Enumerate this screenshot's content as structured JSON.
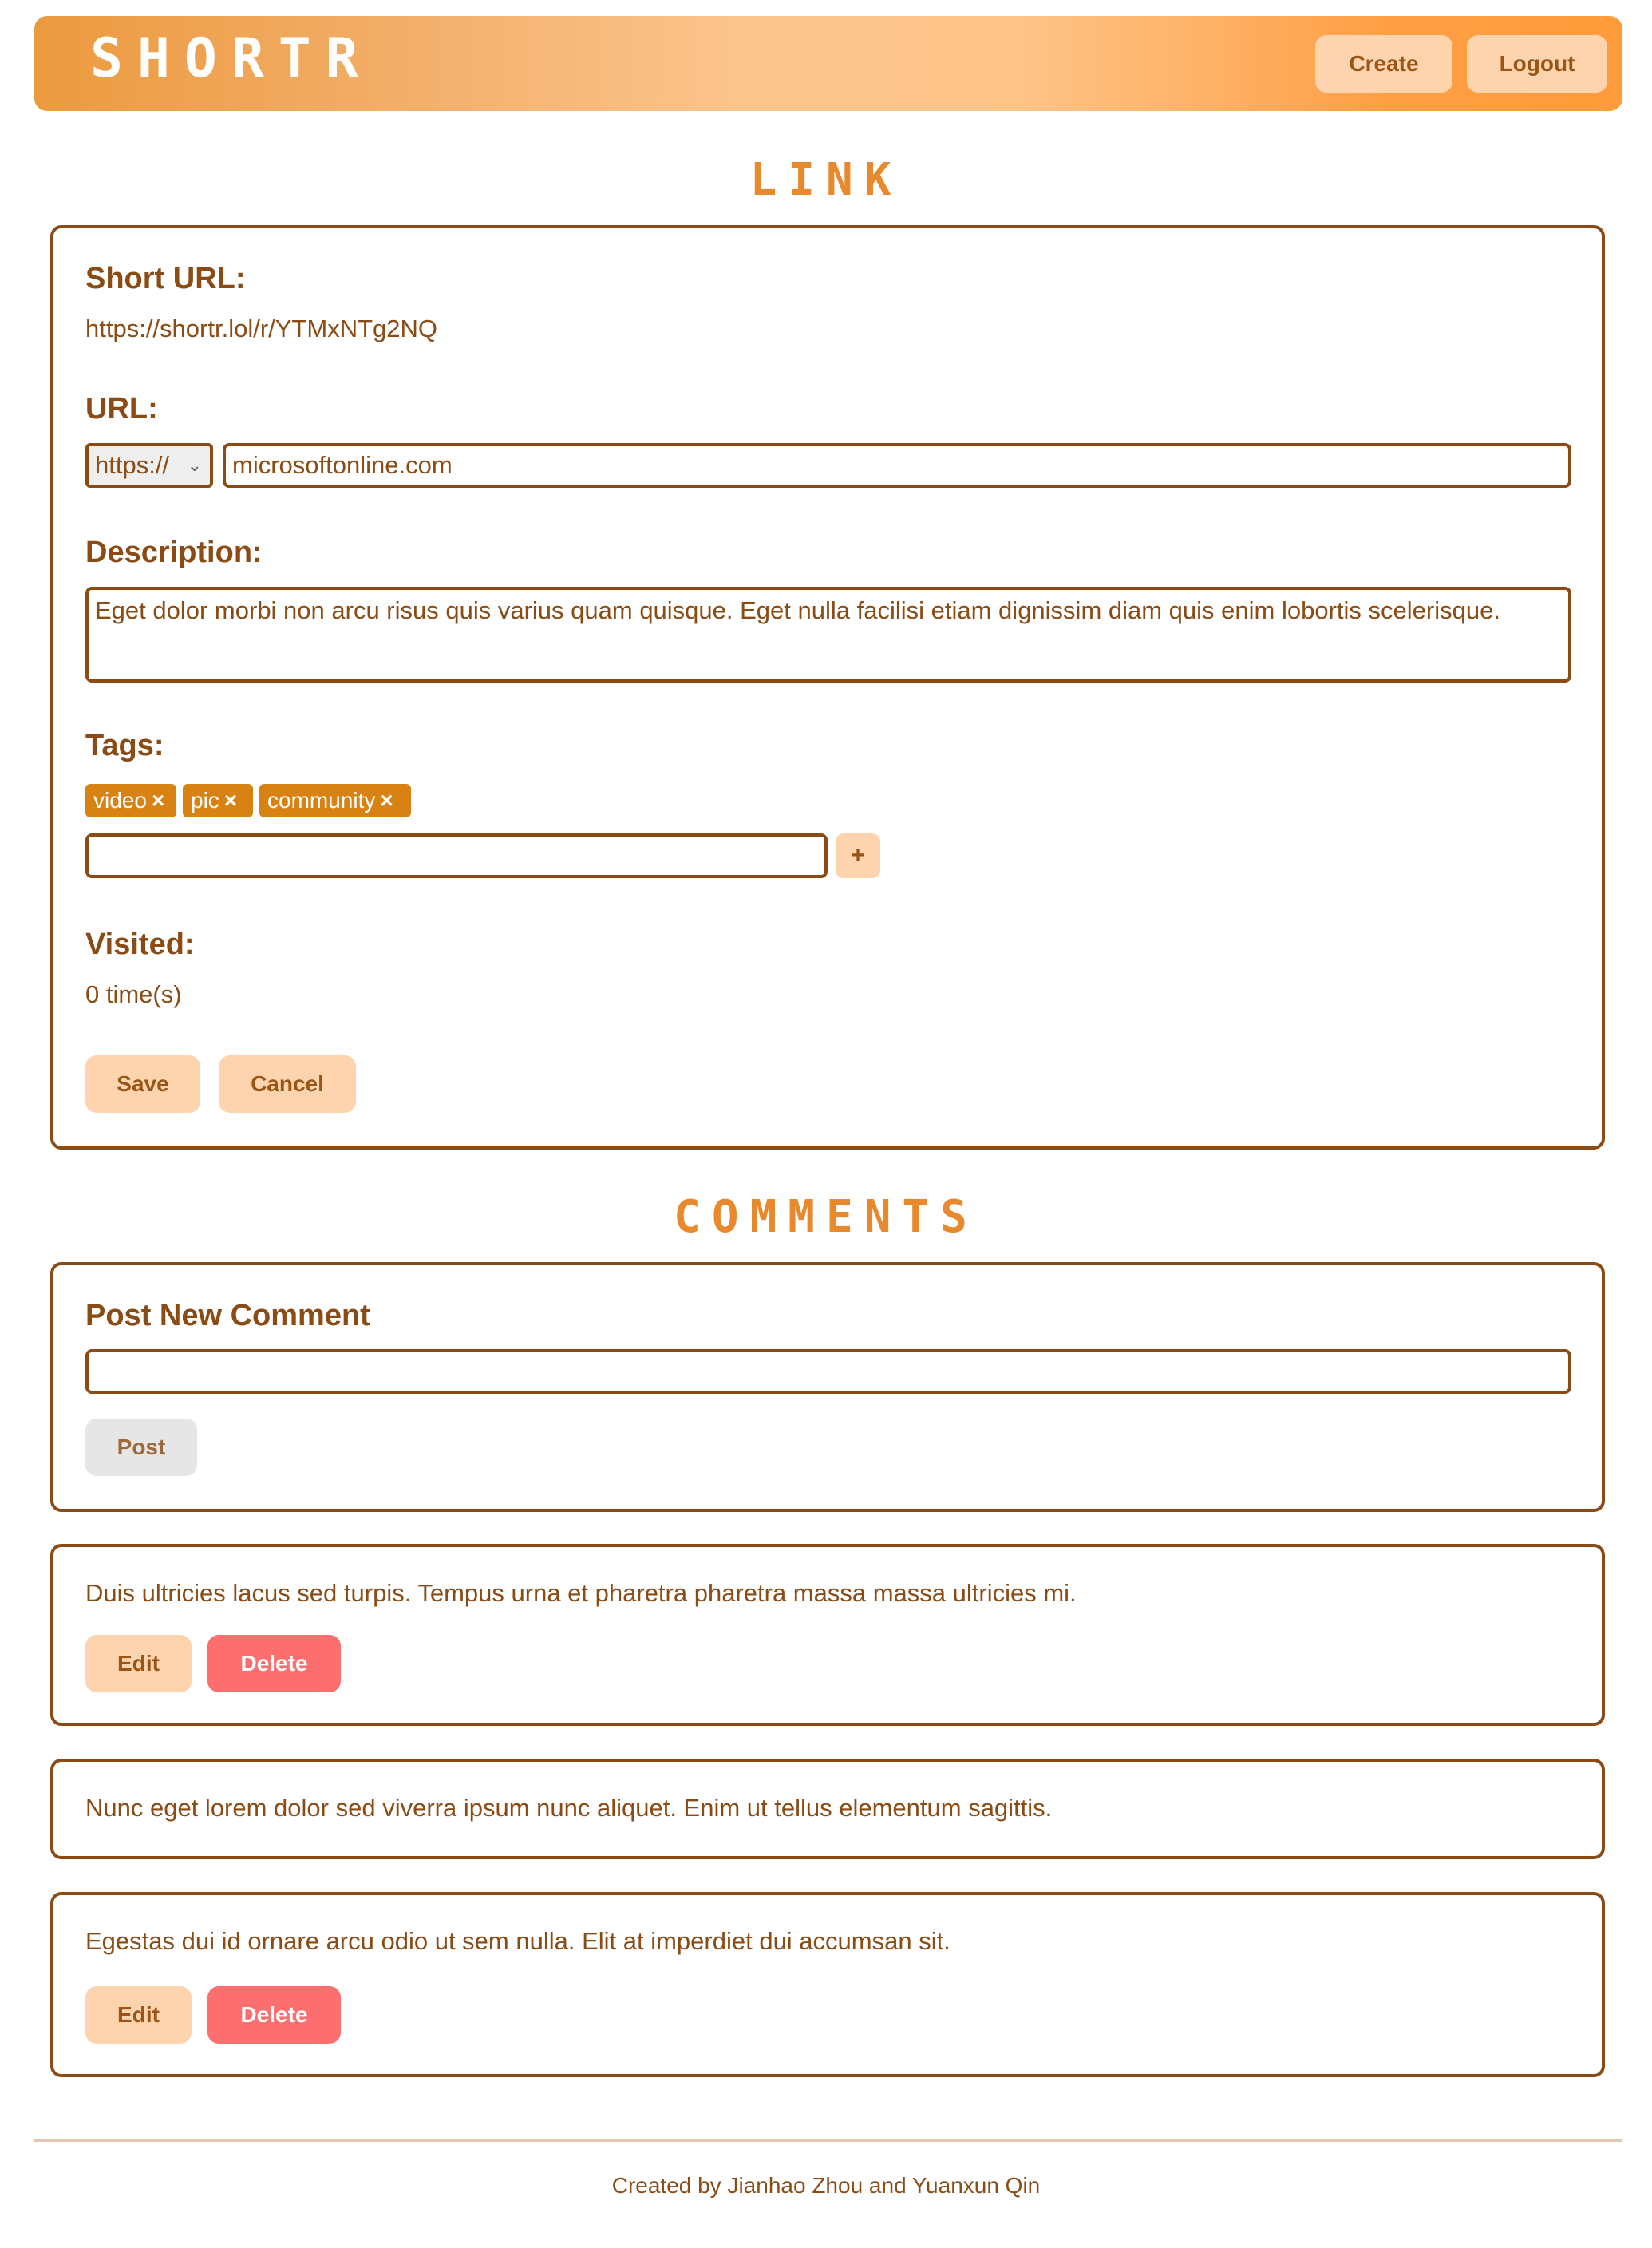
{
  "header": {
    "brand": "SHORTR",
    "create_label": "Create",
    "logout_label": "Logout"
  },
  "link_section": {
    "title": "LINK",
    "short_url_label": "Short URL:",
    "short_url_value": "https://shortr.lol/r/YTMxNTg2NQ",
    "url_label": "URL:",
    "protocol_selected": "https://",
    "url_value": "microsoftonline.com",
    "description_label": "Description:",
    "description_value": "Eget dolor morbi non arcu risus quis varius quam quisque. Eget nulla facilisi etiam dignissim diam quis enim lobortis scelerisque.",
    "tags_label": "Tags:",
    "tags": [
      {
        "label": "video",
        "remove": "×"
      },
      {
        "label": "pic",
        "remove": "×"
      },
      {
        "label": "community",
        "remove": "×"
      }
    ],
    "tag_input_value": "",
    "add_tag_label": "+",
    "visited_label": "Visited:",
    "visited_value": "0 time(s)",
    "save_label": "Save",
    "cancel_label": "Cancel"
  },
  "comments_section": {
    "title": "COMMENTS",
    "post_heading": "Post New Comment",
    "comment_input_value": "",
    "post_label": "Post",
    "comments": [
      {
        "text": "Duis ultricies lacus sed turpis. Tempus urna et pharetra pharetra massa massa ultricies mi.",
        "edit_label": "Edit",
        "delete_label": "Delete"
      },
      {
        "text": "Nunc eget lorem dolor sed viverra ipsum nunc aliquet. Enim ut tellus elementum sagittis."
      },
      {
        "text": "Egestas dui id ornare arcu odio ut sem nulla. Elit at imperdiet dui accumsan sit.",
        "edit_label": "Edit",
        "delete_label": "Delete"
      }
    ]
  },
  "footer": {
    "credit": "Created by Jianhao Zhou and Yuanxun Qin"
  },
  "colors": {
    "primary_text": "#8a4b14",
    "accent": "#e8892e",
    "button_bg": "#fdd4ae",
    "delete_bg": "#fd6e6e",
    "tag_bg": "#d98214"
  },
  "icons": {
    "select_chevron": "chevron-down-icon",
    "tag_remove": "close-icon",
    "add_tag": "plus-icon"
  }
}
